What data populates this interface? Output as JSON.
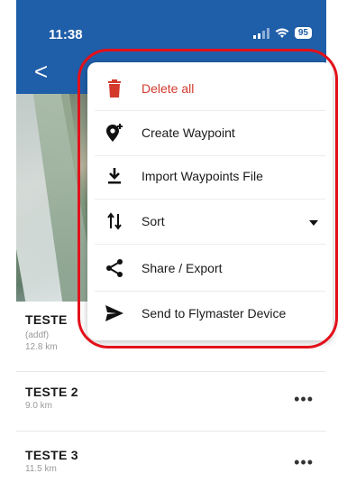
{
  "status_bar": {
    "time": "11:38",
    "battery": "95"
  },
  "nav": {
    "back_label": "<"
  },
  "list": {
    "items": [
      {
        "title": "TESTE",
        "subtitle": "(addf)",
        "distance": "12.8 km"
      },
      {
        "title": "TESTE 2",
        "subtitle": "",
        "distance": "9.0 km",
        "more": "•••"
      },
      {
        "title": "TESTE 3",
        "subtitle": "",
        "distance": "11.5 km",
        "more": "•••"
      }
    ]
  },
  "menu": {
    "delete_all": "Delete all",
    "create_waypoint": "Create Waypoint",
    "import_waypoints": "Import Waypoints File",
    "sort": "Sort",
    "share_export": "Share / Export",
    "send_device": "Send to Flymaster Device"
  },
  "colors": {
    "topbar": "#1f5ea8",
    "danger": "#d33a2c",
    "annotation": "#e3101a"
  },
  "icons": {
    "delete": "trash-icon",
    "create": "map-pin-plus-icon",
    "import": "download-icon",
    "sort": "sort-icon",
    "share": "share-icon",
    "send": "send-icon"
  }
}
